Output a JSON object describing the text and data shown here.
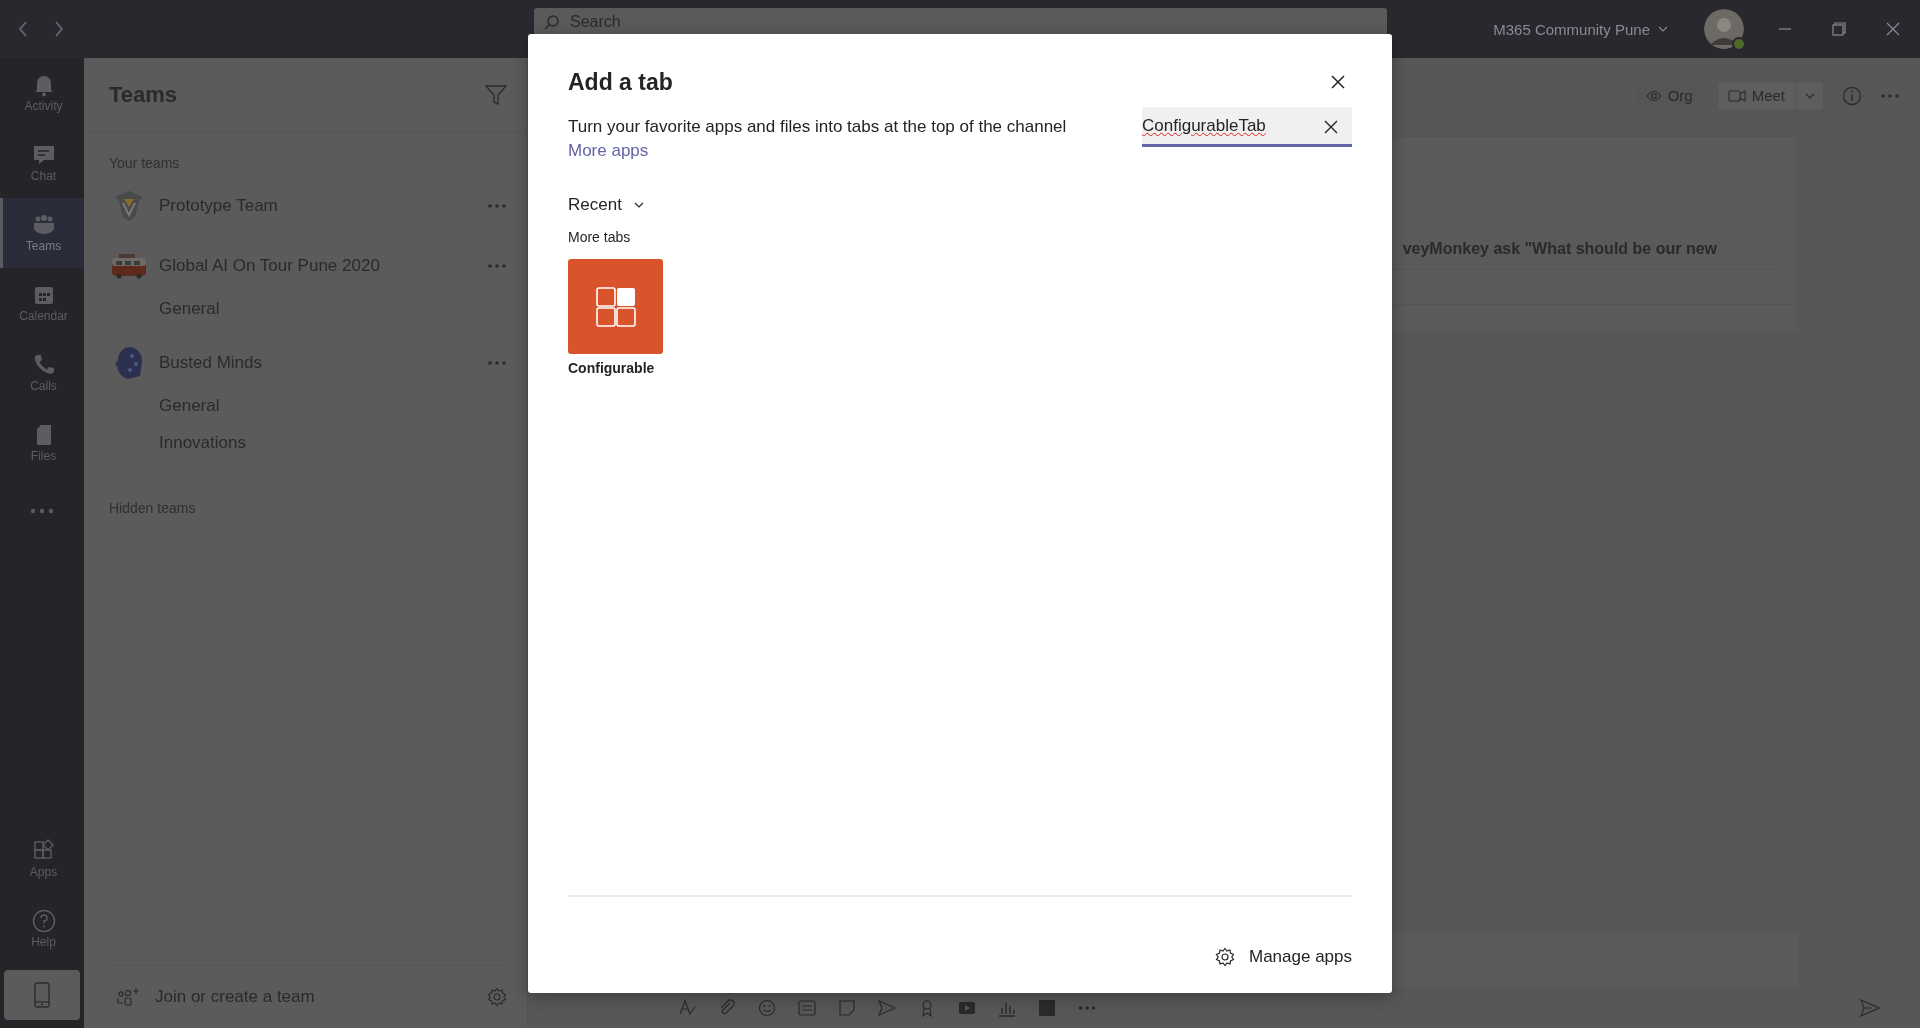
{
  "title_bar": {
    "search_placeholder": "Search",
    "account": "M365 Community Pune"
  },
  "rail": {
    "items": [
      {
        "label": "Activity",
        "selected": false
      },
      {
        "label": "Chat",
        "selected": false
      },
      {
        "label": "Teams",
        "selected": true
      },
      {
        "label": "Calendar",
        "selected": false
      },
      {
        "label": "Calls",
        "selected": false
      },
      {
        "label": "Files",
        "selected": false
      }
    ],
    "bottom_items": [
      {
        "label": "Apps",
        "selected": false
      },
      {
        "label": "Help",
        "selected": false
      }
    ]
  },
  "teams_panel": {
    "title": "Teams",
    "section": "Your teams",
    "teams": [
      {
        "name": "Prototype Team"
      },
      {
        "name": "Global AI On Tour Pune 2020",
        "channels": [
          {
            "name": "General"
          }
        ]
      },
      {
        "name": "Busted Minds",
        "channels": [
          {
            "name": "General"
          },
          {
            "name": "Innovations"
          }
        ]
      }
    ],
    "hidden_section": "Hidden teams",
    "join": "Join or create a team"
  },
  "channel_header": {
    "buttons": [
      {
        "label": "Org",
        "kind": "view"
      },
      {
        "label": "Meet",
        "kind": "meet"
      }
    ]
  },
  "post": {
    "text": "veyMonkey ask \"What should be our new"
  },
  "dialog": {
    "title": "Add a tab",
    "description": "Turn your favorite apps and files into tabs at the top of the channel",
    "link": "More apps",
    "search_value": "ConfigurableTab",
    "filter": "Recent",
    "section": "More tabs",
    "apps": [
      {
        "name": "Configurable"
      }
    ],
    "manage": "Manage apps"
  }
}
